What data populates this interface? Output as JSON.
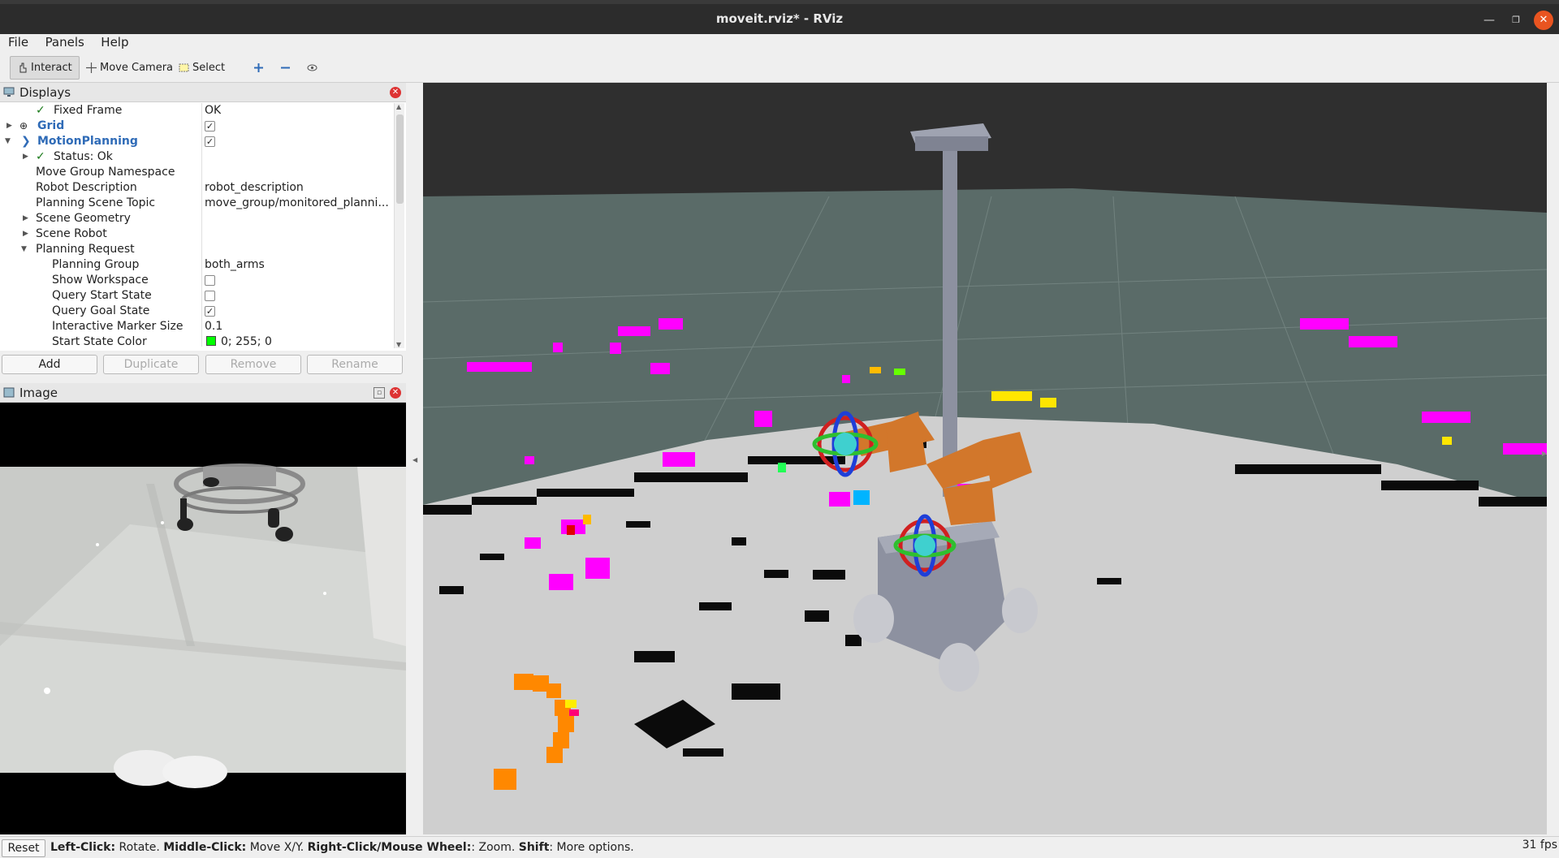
{
  "window": {
    "title": "moveit.rviz* - RViz"
  },
  "menu": [
    "File",
    "Panels",
    "Help"
  ],
  "toolbar": {
    "interact": "Interact",
    "move_camera": "Move Camera",
    "select": "Select"
  },
  "displays": {
    "title": "Displays",
    "rows": [
      {
        "name": "Fixed Frame",
        "value": "OK"
      },
      {
        "name": "Grid",
        "value": ""
      },
      {
        "name": "MotionPlanning",
        "value": ""
      },
      {
        "name": "Status: Ok",
        "value": ""
      },
      {
        "name": "Move Group Namespace",
        "value": ""
      },
      {
        "name": "Robot Description",
        "value": "robot_description"
      },
      {
        "name": "Planning Scene Topic",
        "value": "move_group/monitored_planni..."
      },
      {
        "name": "Scene Geometry",
        "value": ""
      },
      {
        "name": "Scene Robot",
        "value": ""
      },
      {
        "name": "Planning Request",
        "value": ""
      },
      {
        "name": "Planning Group",
        "value": "both_arms"
      },
      {
        "name": "Show Workspace",
        "value": ""
      },
      {
        "name": "Query Start State",
        "value": ""
      },
      {
        "name": "Query Goal State",
        "value": ""
      },
      {
        "name": "Interactive Marker Size",
        "value": "0.1"
      },
      {
        "name": "Start State Color",
        "value": "0; 255; 0"
      }
    ],
    "buttons": {
      "add": "Add",
      "duplicate": "Duplicate",
      "remove": "Remove",
      "rename": "Rename"
    }
  },
  "image_panel": {
    "title": "Image"
  },
  "status": {
    "reset": "Reset",
    "hint_b1": "Left-Click:",
    "hint_t1": " Rotate. ",
    "hint_b2": "Middle-Click:",
    "hint_t2": " Move X/Y. ",
    "hint_b3": "Right-Click/Mouse Wheel:",
    "hint_t3": ": Zoom. ",
    "hint_b4": "Shift",
    "hint_t4": ": More options.",
    "fps": "31 fps"
  },
  "colors": {
    "start_state": "#00ff00",
    "highlight_blue": "#2f6bb7",
    "marker_magenta": "#ff00ff"
  }
}
